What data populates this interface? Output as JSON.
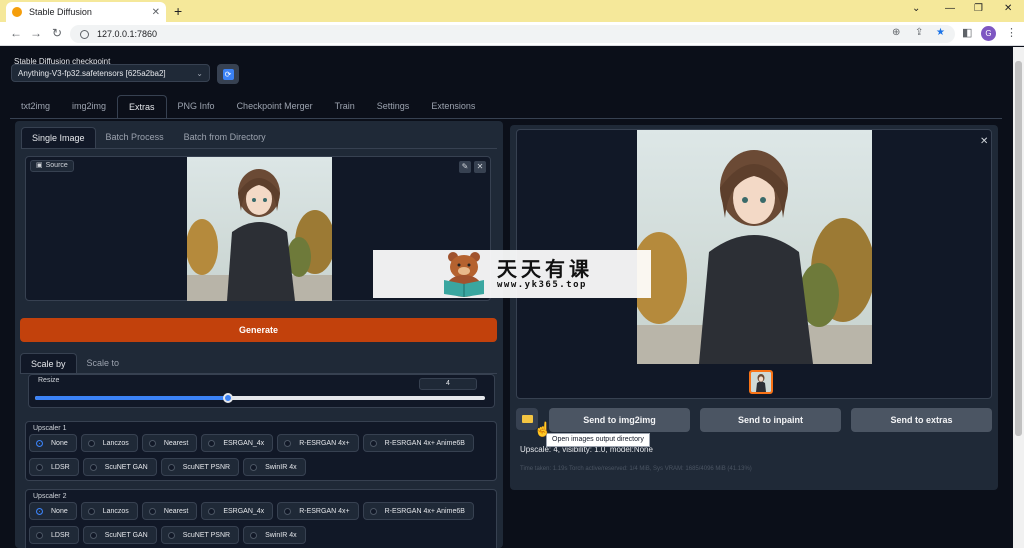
{
  "browser": {
    "tab_title": "Stable Diffusion",
    "url": "127.0.0.1:7860",
    "profile_initial": "G"
  },
  "checkpoint": {
    "label": "Stable Diffusion checkpoint",
    "value": "Anything-V3-fp32.safetensors [625a2ba2]"
  },
  "main_tabs": [
    "txt2img",
    "img2img",
    "Extras",
    "PNG Info",
    "Checkpoint Merger",
    "Train",
    "Settings",
    "Extensions"
  ],
  "sub_tabs": [
    "Single Image",
    "Batch Process",
    "Batch from Directory"
  ],
  "source_label": "Source",
  "generate_label": "Generate",
  "scale_tabs": [
    "Scale by",
    "Scale to"
  ],
  "resize": {
    "label": "Resize",
    "value": "4",
    "min": 1,
    "max": 8,
    "current": 4
  },
  "upscaler1": {
    "title": "Upscaler 1",
    "options": [
      "None",
      "Lanczos",
      "Nearest",
      "ESRGAN_4x",
      "R-ESRGAN 4x+",
      "R-ESRGAN 4x+ Anime6B",
      "LDSR",
      "ScuNET GAN",
      "ScuNET PSNR",
      "SwinIR 4x"
    ],
    "selected": "None"
  },
  "upscaler2": {
    "title": "Upscaler 2",
    "options": [
      "None",
      "Lanczos",
      "Nearest",
      "ESRGAN_4x",
      "R-ESRGAN 4x+",
      "R-ESRGAN 4x+ Anime6B",
      "LDSR",
      "ScuNET GAN",
      "ScuNET PSNR",
      "SwinIR 4x"
    ],
    "selected": "None"
  },
  "output": {
    "send_img2img": "Send to img2img",
    "send_inpaint": "Send to inpaint",
    "send_extras": "Send to extras",
    "tooltip": "Open images output directory",
    "info": "Upscale: 4, visibility: 1.0, model:None",
    "perf": "Time taken: 1.19s  Torch active/reserved: 1/4 MiB, Sys VRAM: 1685/4096 MiB (41.13%)"
  },
  "watermark": {
    "title": "天天有课",
    "url": "www.yk365.top"
  },
  "colors": {
    "accent": "#c2410c",
    "selected": "#3b82f6",
    "chrome": "#f5e89a"
  }
}
